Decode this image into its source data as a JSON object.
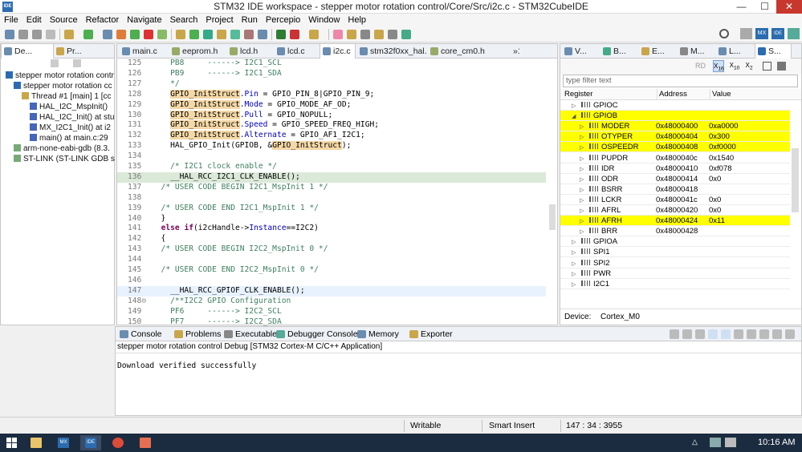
{
  "window": {
    "title": "STM32 IDE workspace - stepper motor rotation control/Core/Src/i2c.c - STM32CubeIDE",
    "app_icon": "IDE",
    "minimize": "—",
    "maximize": "☐",
    "close": "✕"
  },
  "menu": [
    "File",
    "Edit",
    "Source",
    "Refactor",
    "Navigate",
    "Search",
    "Project",
    "Run",
    "Percepio",
    "Window",
    "Help"
  ],
  "left_tabs": [
    {
      "label": "De...",
      "icon": "debug-icon"
    },
    {
      "label": "Pr...",
      "icon": "project-icon"
    }
  ],
  "debug_tree": [
    {
      "label": "stepper motor rotation contr",
      "icon": "ide-launch-icon",
      "indent": 0
    },
    {
      "label": "stepper motor rotation cc",
      "icon": "ide-process-icon",
      "indent": 1
    },
    {
      "label": "Thread #1 [main] 1 [cc",
      "icon": "thread-icon",
      "indent": 2
    },
    {
      "label": "HAL_I2C_MspInit()",
      "icon": "stack-frame-icon",
      "indent": 3
    },
    {
      "label": "HAL_I2C_Init() at stu",
      "icon": "stack-frame-icon",
      "indent": 3
    },
    {
      "label": "MX_I2C1_Init() at i2",
      "icon": "stack-frame-icon",
      "indent": 3
    },
    {
      "label": "main() at main.c:29",
      "icon": "stack-frame-icon",
      "indent": 3
    },
    {
      "label": "arm-none-eabi-gdb (8.3.",
      "icon": "gdb-icon",
      "indent": 1
    },
    {
      "label": "ST-LINK (ST-LINK GDB se",
      "icon": "stlink-icon",
      "indent": 1
    }
  ],
  "editor_tabs": [
    "main.c",
    "eeprom.h",
    "lcd.h",
    "lcd.c",
    "i2c.c",
    "stm32f0xx_hal.c",
    "core_cm0.h",
    "»1"
  ],
  "editor_lines": [
    {
      "n": "125",
      "text": "    PB8     ------> I2C1_SCL",
      "cls": "cmt"
    },
    {
      "n": "126",
      "text": "    PB9     ------> I2C1_SDA",
      "cls": "cmt"
    },
    {
      "n": "127",
      "text": "    */",
      "cls": "cmt"
    },
    {
      "n": "128",
      "pre": "    ",
      "var": "GPIO_InitStruct",
      "field": ".Pin",
      "rest": " = GPIO_PIN_8|GPIO_PIN_9;"
    },
    {
      "n": "129",
      "pre": "    ",
      "var": "GPIO_InitStruct",
      "field": ".Mode",
      "rest": " = GPIO_MODE_AF_OD;"
    },
    {
      "n": "130",
      "pre": "    ",
      "var": "GPIO_InitStruct",
      "field": ".Pull",
      "rest": " = GPIO_NOPULL;"
    },
    {
      "n": "131",
      "pre": "    ",
      "var": "GPIO_InitStruct",
      "field": ".Speed",
      "rest": " = GPIO_SPEED_FREQ_HIGH;"
    },
    {
      "n": "132",
      "pre": "    ",
      "var": "GPIO_InitStruct",
      "field": ".Alternate",
      "rest": " = GPIO_AF1_I2C1;"
    },
    {
      "n": "133",
      "text": "    HAL_GPIO_Init(GPIOB, &",
      "var2": "GPIO_InitStruct",
      "tail": ");"
    },
    {
      "n": "134",
      "text": "",
      "cls": ""
    },
    {
      "n": "135",
      "text": "    /* I2C1 clock enable */",
      "cls": "cmt"
    },
    {
      "n": "136",
      "text": "    __HAL_RCC_I2C1_CLK_ENABLE();",
      "cls": "current"
    },
    {
      "n": "137",
      "text": "  /* USER CODE BEGIN I2C1_MspInit 1 */",
      "cls": "cmt"
    },
    {
      "n": "138",
      "text": "",
      "cls": ""
    },
    {
      "n": "139",
      "text": "  /* USER CODE END I2C1_MspInit 1 */",
      "cls": "cmt"
    },
    {
      "n": "140",
      "text": "  }",
      "cls": ""
    },
    {
      "n": "141",
      "kw": "else if",
      "text": "(i2cHandle->",
      "field2": "Instance",
      "tail": "==I2C2)"
    },
    {
      "n": "142",
      "text": "  {",
      "cls": ""
    },
    {
      "n": "143",
      "text": "  /* USER CODE BEGIN I2C2_MspInit 0 */",
      "cls": "cmt"
    },
    {
      "n": "144",
      "text": "",
      "cls": ""
    },
    {
      "n": "145",
      "text": "  /* USER CODE END I2C2_MspInit 0 */",
      "cls": "cmt"
    },
    {
      "n": "146",
      "text": "",
      "cls": ""
    },
    {
      "n": "147",
      "text": "    __HAL_RCC_GPIOF_CLK_ENABLE();",
      "cls": "cursor"
    },
    {
      "n": "148⊝",
      "text": "    /**I2C2 GPIO Configuration",
      "cls": "cmt"
    },
    {
      "n": "149",
      "text": "    PF6     ------> I2C2_SCL",
      "cls": "cmt"
    },
    {
      "n": "150",
      "text": "    PF7     ------> I2C2_SDA",
      "cls": "cmt"
    }
  ],
  "right_tabs": [
    {
      "label": "V...",
      "icon": "variables-icon",
      "prefix": "(x)="
    },
    {
      "label": "B...",
      "icon": "breakpoints-icon"
    },
    {
      "label": "E...",
      "icon": "expressions-icon"
    },
    {
      "label": "M...",
      "icon": "modules-icon"
    },
    {
      "label": "L...",
      "icon": "live-expressions-icon"
    },
    {
      "label": "S...",
      "icon": "sfr-icon"
    }
  ],
  "registers": {
    "filter_placeholder": "type filter text",
    "rd_label": "RD",
    "headers": [
      "Register",
      "Address",
      "Value"
    ],
    "rows": [
      {
        "name": "GPIOC",
        "addr": "",
        "val": "",
        "level": 0,
        "expanded": false,
        "highlight": false
      },
      {
        "name": "GPIOB",
        "addr": "",
        "val": "",
        "level": 0,
        "expanded": true,
        "highlight": true
      },
      {
        "name": "MODER",
        "addr": "0x48000400",
        "val": "0xa0000",
        "level": 1,
        "expanded": false,
        "highlight": true
      },
      {
        "name": "OTYPER",
        "addr": "0x48000404",
        "val": "0x300",
        "level": 1,
        "expanded": false,
        "highlight": true
      },
      {
        "name": "OSPEEDR",
        "addr": "0x48000408",
        "val": "0xf0000",
        "level": 1,
        "expanded": false,
        "highlight": true
      },
      {
        "name": "PUPDR",
        "addr": "0x4800040c",
        "val": "0x1540",
        "level": 1,
        "expanded": false,
        "highlight": false
      },
      {
        "name": "IDR",
        "addr": "0x48000410",
        "val": "0xf078",
        "level": 1,
        "expanded": false,
        "highlight": false
      },
      {
        "name": "ODR",
        "addr": "0x48000414",
        "val": "0x0",
        "level": 1,
        "expanded": false,
        "highlight": false
      },
      {
        "name": "BSRR",
        "addr": "0x48000418",
        "val": "",
        "level": 1,
        "expanded": false,
        "highlight": false
      },
      {
        "name": "LCKR",
        "addr": "0x4800041c",
        "val": "0x0",
        "level": 1,
        "expanded": false,
        "highlight": false
      },
      {
        "name": "AFRL",
        "addr": "0x48000420",
        "val": "0x0",
        "level": 1,
        "expanded": false,
        "highlight": false
      },
      {
        "name": "AFRH",
        "addr": "0x48000424",
        "val": "0x11",
        "level": 1,
        "expanded": false,
        "highlight": true
      },
      {
        "name": "BRR",
        "addr": "0x48000428",
        "val": "",
        "level": 1,
        "expanded": false,
        "highlight": false
      },
      {
        "name": "GPIOA",
        "addr": "",
        "val": "",
        "level": 0,
        "expanded": false,
        "highlight": false
      },
      {
        "name": "SPI1",
        "addr": "",
        "val": "",
        "level": 0,
        "expanded": false,
        "highlight": false
      },
      {
        "name": "SPI2",
        "addr": "",
        "val": "",
        "level": 0,
        "expanded": false,
        "highlight": false
      },
      {
        "name": "PWR",
        "addr": "",
        "val": "",
        "level": 0,
        "expanded": false,
        "highlight": false
      },
      {
        "name": "I2C1",
        "addr": "",
        "val": "",
        "level": 0,
        "expanded": false,
        "highlight": false
      }
    ],
    "device_label": "Device:",
    "device_value": "Cortex_M0"
  },
  "console": {
    "tabs": [
      {
        "label": "Console",
        "icon": "console-icon"
      },
      {
        "label": "Problems",
        "icon": "problems-icon"
      },
      {
        "label": "Executables",
        "icon": "executables-icon"
      },
      {
        "label": "Debugger Console",
        "icon": "debugger-console-icon"
      },
      {
        "label": "Memory",
        "icon": "memory-icon"
      },
      {
        "label": "Exporter",
        "icon": "exporter-icon"
      }
    ],
    "session": "stepper motor rotation control Debug [STM32 Cortex-M C/C++ Application]",
    "output": "Download verified successfully"
  },
  "status": {
    "writable": "Writable",
    "insert_mode": "Smart Insert",
    "position": "147 : 34 : 3955"
  },
  "taskbar": {
    "apps": [
      "file-explorer-icon",
      "cubemx-icon",
      "ide-icon",
      "chrome-icon",
      "paint-icon"
    ],
    "app_labels": [
      "",
      "MX",
      "IDE",
      "",
      ""
    ],
    "time": "10:16 AM"
  },
  "colors": {
    "highlight_yellow": "#ffff00",
    "current_line": "#dbe9d8",
    "comment": "#3f7f5f",
    "keyword": "#7f0055",
    "field": "#0000c0",
    "taskbar": "#1c2c40"
  }
}
